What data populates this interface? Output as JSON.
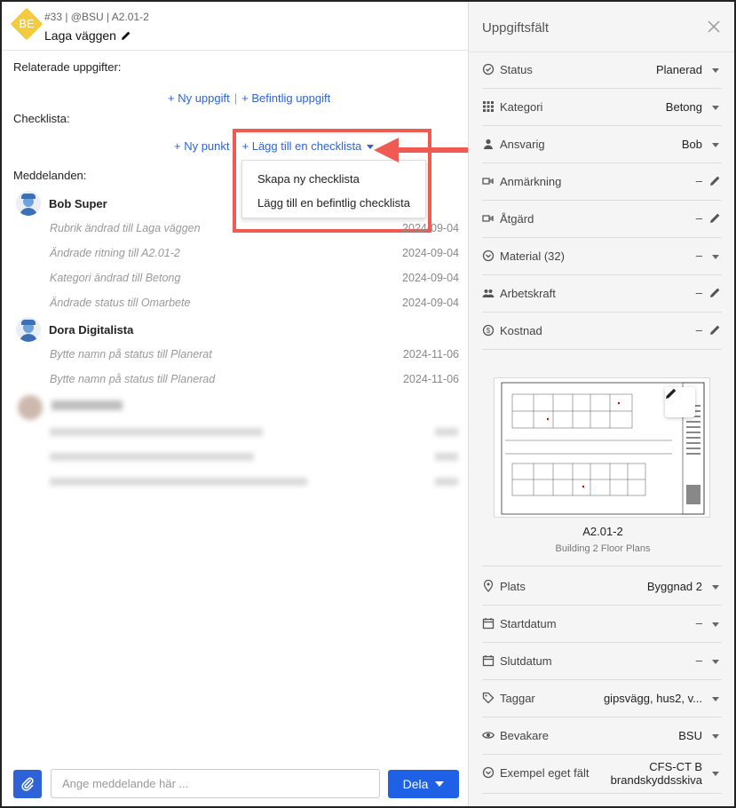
{
  "header": {
    "badge": "BE",
    "meta": "#33 | @BSU | A2.01-2",
    "title": "Laga väggen"
  },
  "related": {
    "label": "Relaterade uppgifter:",
    "new_task": "+ Ny uppgift",
    "separator": "|",
    "existing_task": "+ Befintlig uppgift"
  },
  "checklist": {
    "label": "Checklista:",
    "new_item": "+ Ny punkt",
    "add_checklist": "+ Lägg till en checklista",
    "menu": [
      "Skapa ny checklista",
      "Lägg till en befintlig checklista"
    ]
  },
  "messages": {
    "label": "Meddelanden:",
    "groups": [
      {
        "author": "Bob Super",
        "entries": [
          {
            "text": "Rubrik ändrad till Laga väggen",
            "date": "2024-09-04"
          },
          {
            "text": "Ändrade ritning till A2.01-2",
            "date": "2024-09-04"
          },
          {
            "text": "Kategori ändrad till Betong",
            "date": "2024-09-04"
          },
          {
            "text": "Ändrade status till Omarbete",
            "date": "2024-09-04"
          }
        ]
      },
      {
        "author": "Dora Digitalista",
        "entries": [
          {
            "text": "Bytte namn på status till Planerat",
            "date": "2024-11-06"
          },
          {
            "text": "Bytte namn på status till Planerad",
            "date": "2024-11-06"
          }
        ]
      }
    ]
  },
  "composer": {
    "placeholder": "Ange meddelande här ...",
    "share_label": "Dela"
  },
  "panel": {
    "title": "Uppgiftsfält",
    "fields": [
      {
        "label": "Status",
        "value": "Planerad",
        "icon": "status-icon"
      },
      {
        "label": "Kategori",
        "value": "Betong",
        "icon": "grid-icon"
      },
      {
        "label": "Ansvarig",
        "value": "Bob",
        "icon": "person-icon"
      },
      {
        "label": "Anmärkning",
        "value": "–",
        "icon": "remark-icon"
      },
      {
        "label": "Åtgärd",
        "value": "–",
        "icon": "action-icon"
      },
      {
        "label": "Material (32)",
        "value": "–",
        "icon": "material-icon"
      },
      {
        "label": "Arbetskraft",
        "value": "–",
        "icon": "people-icon"
      },
      {
        "label": "Kostnad",
        "value": "–",
        "icon": "dollar-icon"
      }
    ],
    "drawing": {
      "name": "A2.01-2",
      "description": "Building 2 Floor Plans"
    },
    "fields2": [
      {
        "label": "Plats",
        "value": "Byggnad 2",
        "icon": "location-icon"
      },
      {
        "label": "Startdatum",
        "value": "–",
        "icon": "calendar-icon"
      },
      {
        "label": "Slutdatum",
        "value": "–",
        "icon": "calendar-icon"
      },
      {
        "label": "Taggar",
        "value": "gipsvägg, hus2, v...",
        "icon": "tag-icon"
      },
      {
        "label": "Bevakare",
        "value": "BSU",
        "icon": "eye-icon"
      },
      {
        "label": "Exempel eget fält",
        "value_line1": "CFS-CT B",
        "value_line2": "brandskyddsskiva",
        "icon": "custom-field-icon"
      }
    ]
  },
  "colors": {
    "accent": "#2e63d8",
    "share": "#1e60e6",
    "badge": "#f2cb3f",
    "highlight": "#ef5a52"
  }
}
